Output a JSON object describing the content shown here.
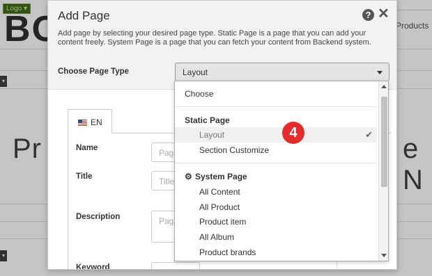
{
  "background": {
    "logo_tag": "Logo ▾",
    "logo_text": "BO",
    "nav_item": "Products",
    "heading_left": "Pr",
    "heading_right": "e N"
  },
  "modal": {
    "title": "Add Page",
    "description": "Add page by selecting your desired page type. Static Page is a page that you can add your content freely. System Page is a page that you can fetch your content from Backend system.",
    "page_type_label": "Choose Page Type",
    "page_type_value": "Layout",
    "language_tab": "EN",
    "fields": {
      "name_label": "Name",
      "name_placeholder": "Pag",
      "title_label": "Title",
      "title_placeholder": "Title",
      "description_label": "Description",
      "description_placeholder": "Pag",
      "keyword_label": "Keyword"
    }
  },
  "dropdown": {
    "choose": "Choose",
    "static_group": "Static Page",
    "static_options": [
      "Layout",
      "Section Customize"
    ],
    "selected": "Layout",
    "system_group": "System Page",
    "system_options": [
      "All Content",
      "All Product",
      "Product item",
      "All Album",
      "Product brands"
    ]
  },
  "step_badge": "4",
  "colors": {
    "badge": "#e52b2b",
    "selected_option_bg": "#f0f0f0"
  },
  "icons": [
    "help-icon",
    "close-icon",
    "chevron-down-icon",
    "flag-icon",
    "check-icon",
    "gear-icon"
  ]
}
